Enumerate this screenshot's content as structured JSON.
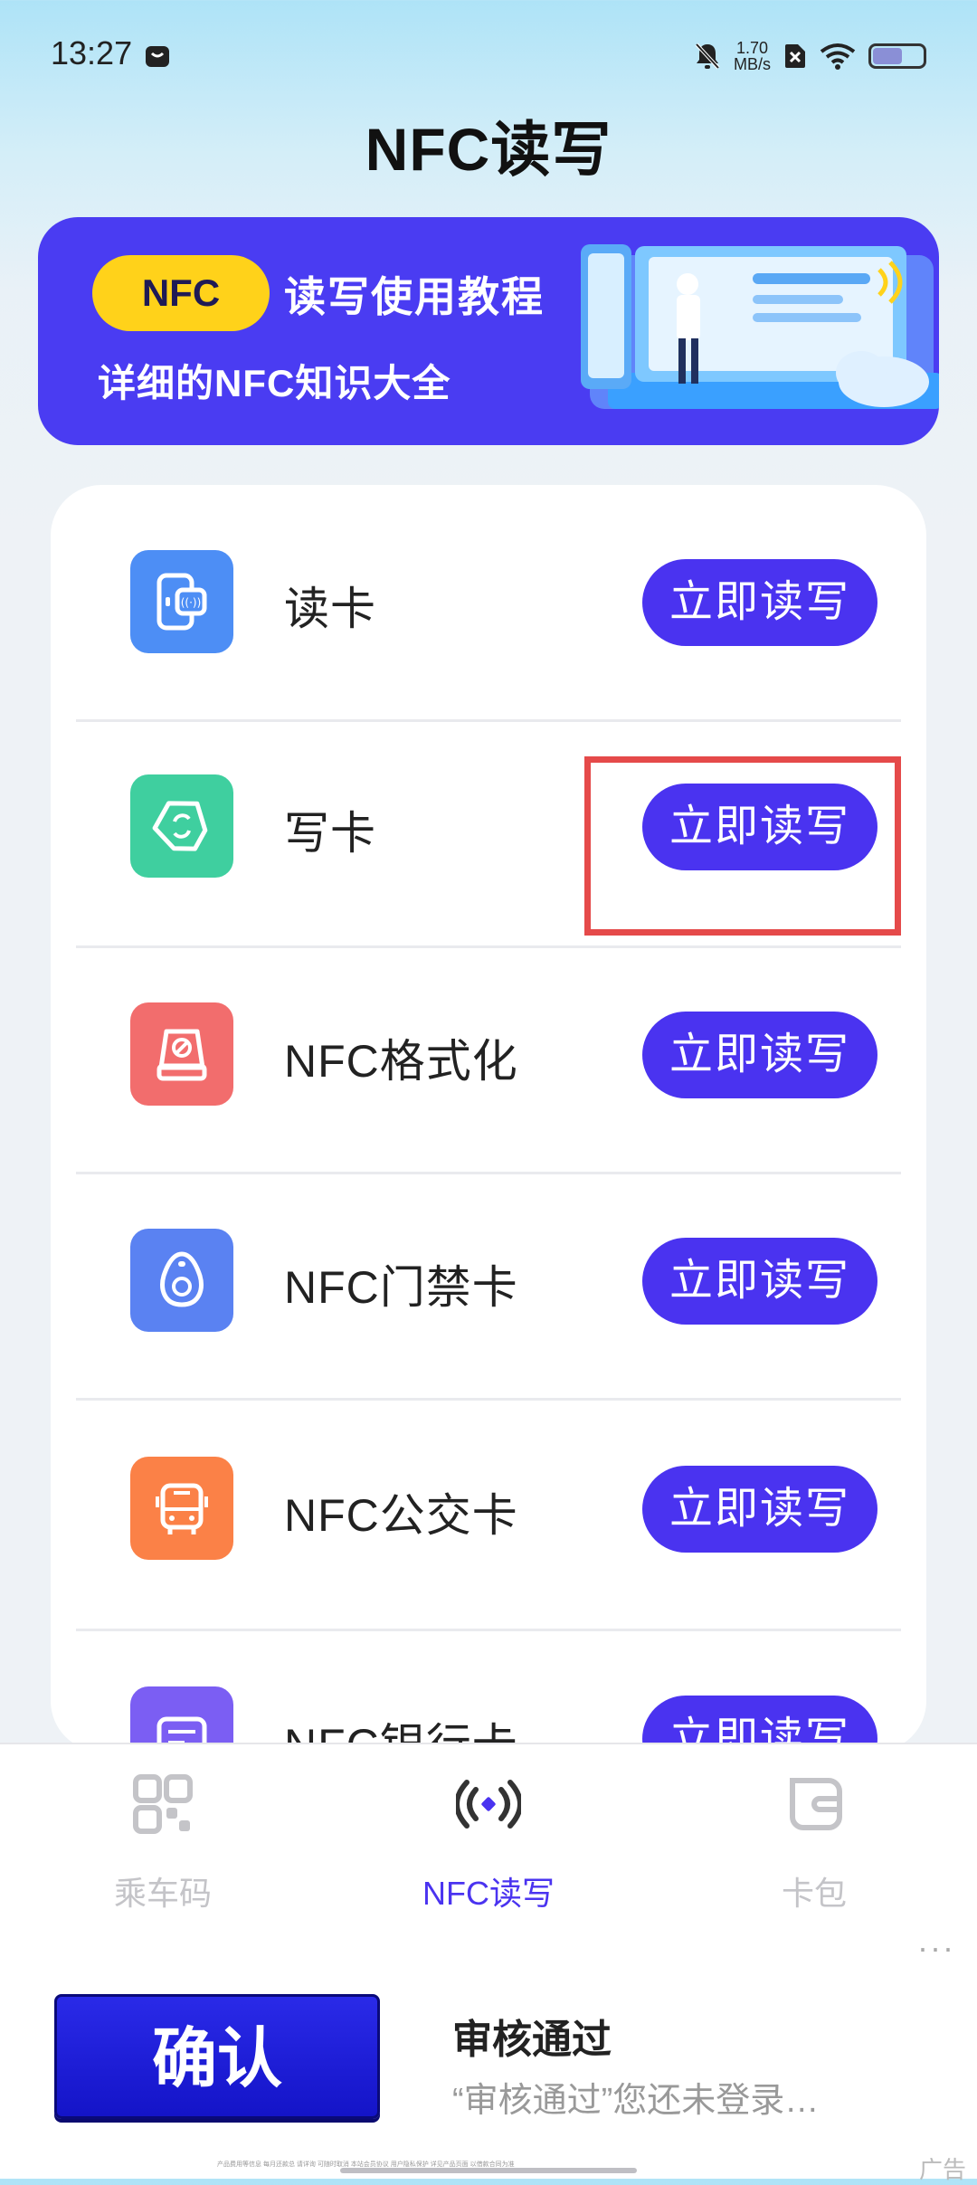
{
  "status_bar": {
    "time": "13:27",
    "speed_value": "1.70",
    "speed_unit": "MB/s",
    "battery_level": 0.6
  },
  "page_title": "NFC读写",
  "banner": {
    "pill": "NFC",
    "title": "读写使用教程",
    "subtitle": "详细的NFC知识大全"
  },
  "features": [
    {
      "label": "读卡",
      "button": "立即读写",
      "icon": "card-reader-icon",
      "color": "#4d8ef5"
    },
    {
      "label": "写卡",
      "button": "立即读写",
      "icon": "tag-write-icon",
      "color": "#3fcf9f"
    },
    {
      "label": "NFC格式化",
      "button": "立即读写",
      "icon": "format-drive-icon",
      "color": "#f26d6d"
    },
    {
      "label": "NFC门禁卡",
      "button": "立即读写",
      "icon": "access-fob-icon",
      "color": "#5a82f2"
    },
    {
      "label": "NFC公交卡",
      "button": "立即读写",
      "icon": "bus-icon",
      "color": "#fb8147"
    },
    {
      "label": "NFC银行卡",
      "button": "立即读写",
      "icon": "bank-card-icon",
      "color": "#7b5ef3"
    }
  ],
  "bottom_nav": {
    "items": [
      {
        "label": "乘车码",
        "icon": "qr-code-icon",
        "active": false
      },
      {
        "label": "NFC读写",
        "icon": "nfc-signal-icon",
        "active": true
      },
      {
        "label": "卡包",
        "icon": "wallet-icon",
        "active": false
      }
    ]
  },
  "ad": {
    "more": "···",
    "confirm_label": "确认",
    "title": "审核通过",
    "description": "“审核通过”您还未登录…",
    "fine_print": "产品费用等信息 每月还款总 请详询 可随时取消 本站会员协议 用户隐私保护 详见产品页面 以借款合同为准",
    "label": "广告"
  },
  "colors": {
    "accent": "#4a33f0",
    "banner_bg": "#4a3cf2",
    "pill_yellow": "#ffd21a",
    "highlight_red": "#e54a4a",
    "nav_active": "#4a33f0",
    "nav_inactive": "#c4c4c8"
  }
}
